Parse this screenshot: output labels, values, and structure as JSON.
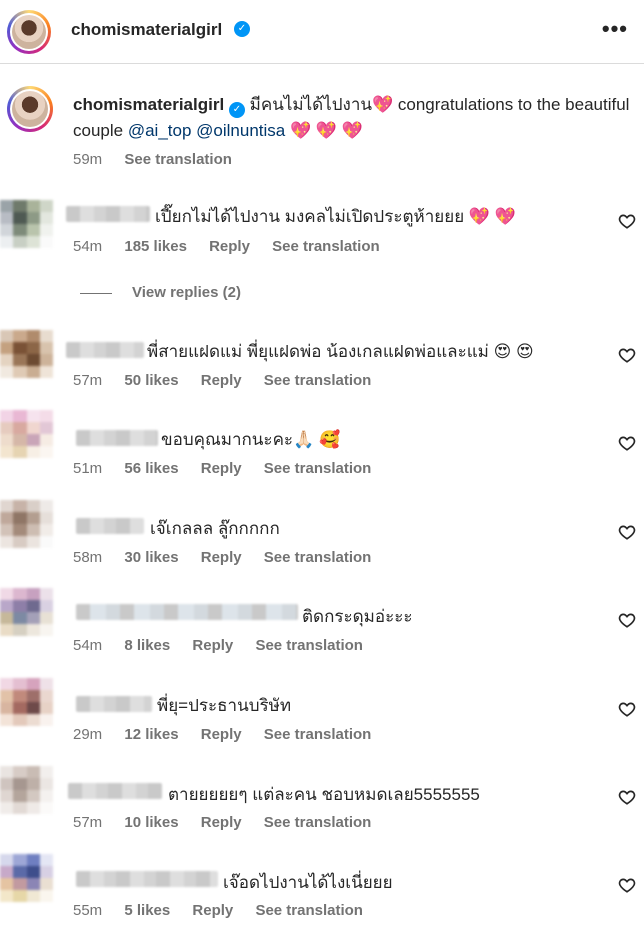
{
  "header": {
    "username": "chomismaterialgirl",
    "verified_icon": "verified-badge-icon",
    "more_label": "•••"
  },
  "caption": {
    "username": "chomismaterialgirl",
    "text_th": "มีคนไม่ได้ไปงาน",
    "heart": "💖",
    "text_en": " congratulations to the beautiful couple ",
    "mention1": "@ai_top",
    "mention2": "@oilnuntisa",
    "hearts": "💖 💖 💖",
    "time": "59m",
    "see_translation": "See translation"
  },
  "comments": [
    {
      "text": "เปี๊ยกไม่ได้ไปงาน มงคลไม่เปิดประตูห้ายยย 💖 💖",
      "time": "54m",
      "likes": "185 likes",
      "reply": "Reply",
      "see_translation": "See translation"
    },
    {
      "text": "พี่สายแฝดแม่ พี่ยุแฝดพ่อ น้องเกลแฝดพ่อและแม่ 😍 😍",
      "time": "57m",
      "likes": "50 likes",
      "reply": "Reply",
      "see_translation": "See translation"
    },
    {
      "text": "ขอบคุณมากนะคะ🙏🏻 🥰",
      "time": "51m",
      "likes": "56 likes",
      "reply": "Reply",
      "see_translation": "See translation"
    },
    {
      "text": "เจ๊เกลลล ลู๊กกกกก",
      "time": "58m",
      "likes": "30 likes",
      "reply": "Reply",
      "see_translation": "See translation"
    },
    {
      "text": "ติดกระดุมอ่ะะะ",
      "time": "54m",
      "likes": "8 likes",
      "reply": "Reply",
      "see_translation": "See translation"
    },
    {
      "text": "พี่ยุ=ประธานบริษัท",
      "time": "29m",
      "likes": "12 likes",
      "reply": "Reply",
      "see_translation": "See translation"
    },
    {
      "text": "ตายยยยยๆ แต่ละคน ชอบหมดเลย5555555",
      "time": "57m",
      "likes": "10 likes",
      "reply": "Reply",
      "see_translation": "See translation"
    },
    {
      "text": "เจ๊อดไปงานได้ไงเนี่ยยย",
      "time": "55m",
      "likes": "5 likes",
      "reply": "Reply",
      "see_translation": "See translation"
    }
  ],
  "view_replies": "View replies (2)",
  "icons": {
    "like": "heart-outline-icon"
  }
}
